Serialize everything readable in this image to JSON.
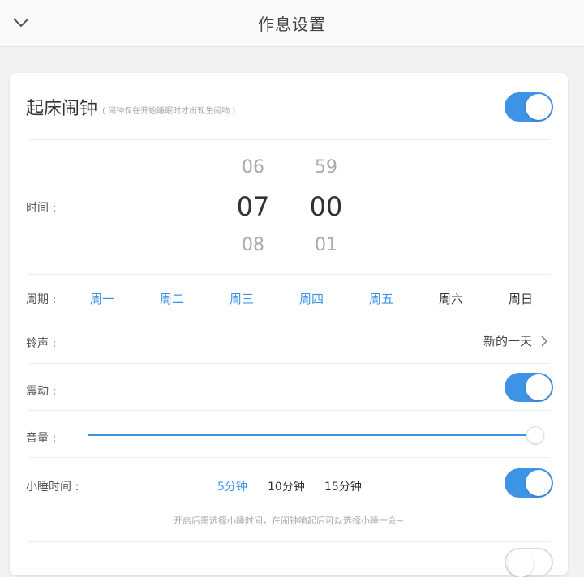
{
  "header": {
    "title": "作息设置",
    "back_icon": "chevron-down-icon"
  },
  "alarm": {
    "title": "起床闹钟",
    "note": "( 闹钟仅在开始睡眠时才出现生闹响 )",
    "enabled": true
  },
  "time": {
    "label": "时间 :",
    "hour_prev": "06",
    "hour_selected": "07",
    "hour_next": "08",
    "minute_prev": "59",
    "minute_selected": "00",
    "minute_next": "01"
  },
  "cycle": {
    "label": "周期 :",
    "days": [
      {
        "label": "周一",
        "on": true
      },
      {
        "label": "周二",
        "on": true
      },
      {
        "label": "周三",
        "on": true
      },
      {
        "label": "周四",
        "on": true
      },
      {
        "label": "周五",
        "on": true
      },
      {
        "label": "周六",
        "on": false
      },
      {
        "label": "周日",
        "on": false
      }
    ]
  },
  "ringtone": {
    "label": "铃声 :",
    "value": "新的一天"
  },
  "vibrate": {
    "label": "震动 :",
    "enabled": true
  },
  "volume": {
    "label": "音量 :",
    "level": 1.0
  },
  "snooze": {
    "label": "小睡时间 :",
    "options": [
      "5分钟",
      "10分钟",
      "15分钟"
    ],
    "selected_index": 0,
    "enabled": true,
    "note": "开启后需选择小睡时间，在闹钟响起后可以选择小睡一会~"
  },
  "colors": {
    "accent": "#3d93e6",
    "background": "#f2f2f4",
    "card": "#ffffff"
  }
}
